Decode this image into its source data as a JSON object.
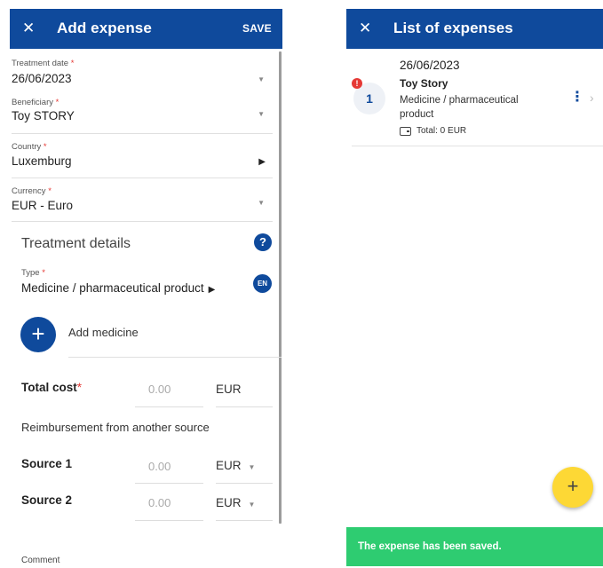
{
  "left": {
    "title": "Add expense",
    "close_icon": "close-icon",
    "save_label": "SAVE",
    "treatment_date": {
      "label": "Treatment date",
      "required": "*",
      "value": "26/06/2023"
    },
    "beneficiary": {
      "label": "Beneficiary",
      "required": "*",
      "value": "Toy STORY"
    },
    "country": {
      "label": "Country",
      "required": "*",
      "value": "Luxemburg"
    },
    "currency": {
      "label": "Currency",
      "required": "*",
      "value": "EUR - Euro"
    },
    "section_title": "Treatment details",
    "help_icon": "?",
    "type": {
      "label": "Type",
      "required": "*",
      "value": "Medicine / pharmaceutical product"
    },
    "lang_badge": "EN",
    "add_icon": "+",
    "add_label": "Add medicine",
    "total_cost": {
      "label": "Total cost",
      "required": "*",
      "placeholder": "0.00",
      "currency": "EUR"
    },
    "reimbursement_label": "Reimbursement from another source",
    "sources": [
      {
        "label": "Source 1",
        "placeholder": "0.00",
        "currency": "EUR"
      },
      {
        "label": "Source 2",
        "placeholder": "0.00",
        "currency": "EUR"
      }
    ],
    "comment_label": "Comment"
  },
  "right": {
    "title": "List of expenses",
    "close_icon": "close-icon",
    "expense": {
      "number": "1",
      "alert": "!",
      "date": "26/06/2023",
      "name": "Toy Story",
      "type": "Medicine / pharmaceutical product",
      "total": "Total: 0 EUR"
    },
    "fab_icon": "+",
    "snackbar": "The expense has been saved."
  },
  "colors": {
    "primary": "#0f4a9c",
    "required": "#e53935",
    "fab": "#fdd835",
    "success": "#2ecc71"
  }
}
